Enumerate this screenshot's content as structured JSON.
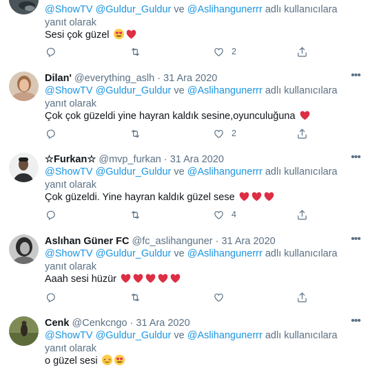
{
  "reply_prefix": "adlı kullanıcılara yanıt olarak",
  "conj": "ve",
  "tweets": [
    {
      "name": "",
      "handle": "",
      "date": "",
      "mentions": [
        "@ShowTV",
        "@Guldur_Guldur",
        "@Aslihangunerrr"
      ],
      "text": "Sesi çok güzel",
      "emojis": [
        "heart-eyes-emoji",
        "red-heart-emoji"
      ],
      "reply_count": "",
      "retweet_count": "",
      "like_count": "2"
    },
    {
      "name": "Dilan'",
      "handle": "@everything_aslh",
      "date": "31 Ara 2020",
      "mentions": [
        "@ShowTV",
        "@Guldur_Guldur",
        "@Aslihangunerrr"
      ],
      "text": "Çok çok güzeldi yine hayran kaldık sesine,oyunculuğuna",
      "emojis": [
        "red-heart-emoji"
      ],
      "reply_count": "",
      "retweet_count": "",
      "like_count": "2"
    },
    {
      "name": "☆Furkan☆",
      "handle": "@mvp_furkan",
      "date": "31 Ara 2020",
      "mentions": [
        "@ShowTV",
        "@Guldur_Guldur",
        "@Aslihangunerrr"
      ],
      "text": "Çok güzeldi. Yine hayran kaldık güzel sese",
      "emojis": [
        "red-heart-emoji",
        "red-heart-emoji",
        "red-heart-emoji"
      ],
      "reply_count": "",
      "retweet_count": "",
      "like_count": "4"
    },
    {
      "name": "Aslıhan Güner FC",
      "handle": "@fc_aslihanguner",
      "date": "31 Ara 2020",
      "mentions": [
        "@ShowTV",
        "@Guldur_Guldur",
        "@Aslihangunerrr"
      ],
      "text": "Aaah sesi hüzür",
      "emojis": [
        "red-heart-emoji",
        "red-heart-emoji",
        "red-heart-emoji",
        "red-heart-emoji",
        "red-heart-emoji"
      ],
      "reply_count": "",
      "retweet_count": "",
      "like_count": ""
    },
    {
      "name": "Cenk",
      "handle": "@Cenkcngo",
      "date": "31 Ara 2020",
      "mentions": [
        "@ShowTV",
        "@Guldur_Guldur",
        "@Aslihangunerrr"
      ],
      "text": "o güzel sesi",
      "emojis": [
        "relieved-face-emoji",
        "heart-eyes-emoji"
      ],
      "reply_count": "",
      "retweet_count": "",
      "like_count": ""
    }
  ],
  "colors": {
    "mention": "#1b95e0",
    "muted": "#5b7083",
    "heart": "#e0245e",
    "border": "#e6ecf0"
  }
}
